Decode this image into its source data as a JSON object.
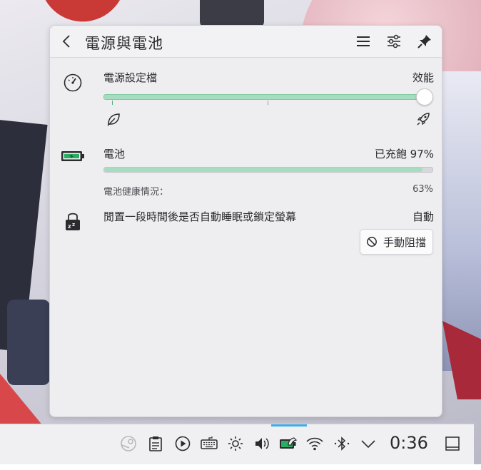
{
  "popup": {
    "title": "電源與電池"
  },
  "power_profile": {
    "label": "電源設定檔",
    "value": "效能",
    "slider_level": 1.0,
    "steps": [
      "power-save",
      "balanced",
      "performance"
    ]
  },
  "battery": {
    "label": "電池",
    "status": "已充飽 97%",
    "charge_percent": 97,
    "health_label": "電池健康情況：",
    "health_value": "63%"
  },
  "inhibition": {
    "label": "閒置一段時間後是否自動睡眠或鎖定螢幕",
    "value": "自動",
    "button_label": "手動阻擋"
  },
  "taskbar": {
    "clock": "0:36",
    "icons": [
      "steam-icon",
      "clipboard-icon",
      "media-player-icon",
      "keyboard-icon",
      "brightness-icon",
      "volume-icon",
      "battery-icon",
      "wifi-icon",
      "bluetooth-icon",
      "expand-tray-icon",
      "show-desktop-icon"
    ]
  },
  "colors": {
    "accent_green": "#a6dcc0",
    "accent_blue": "#3daee9",
    "text": "#2b2b2f"
  }
}
